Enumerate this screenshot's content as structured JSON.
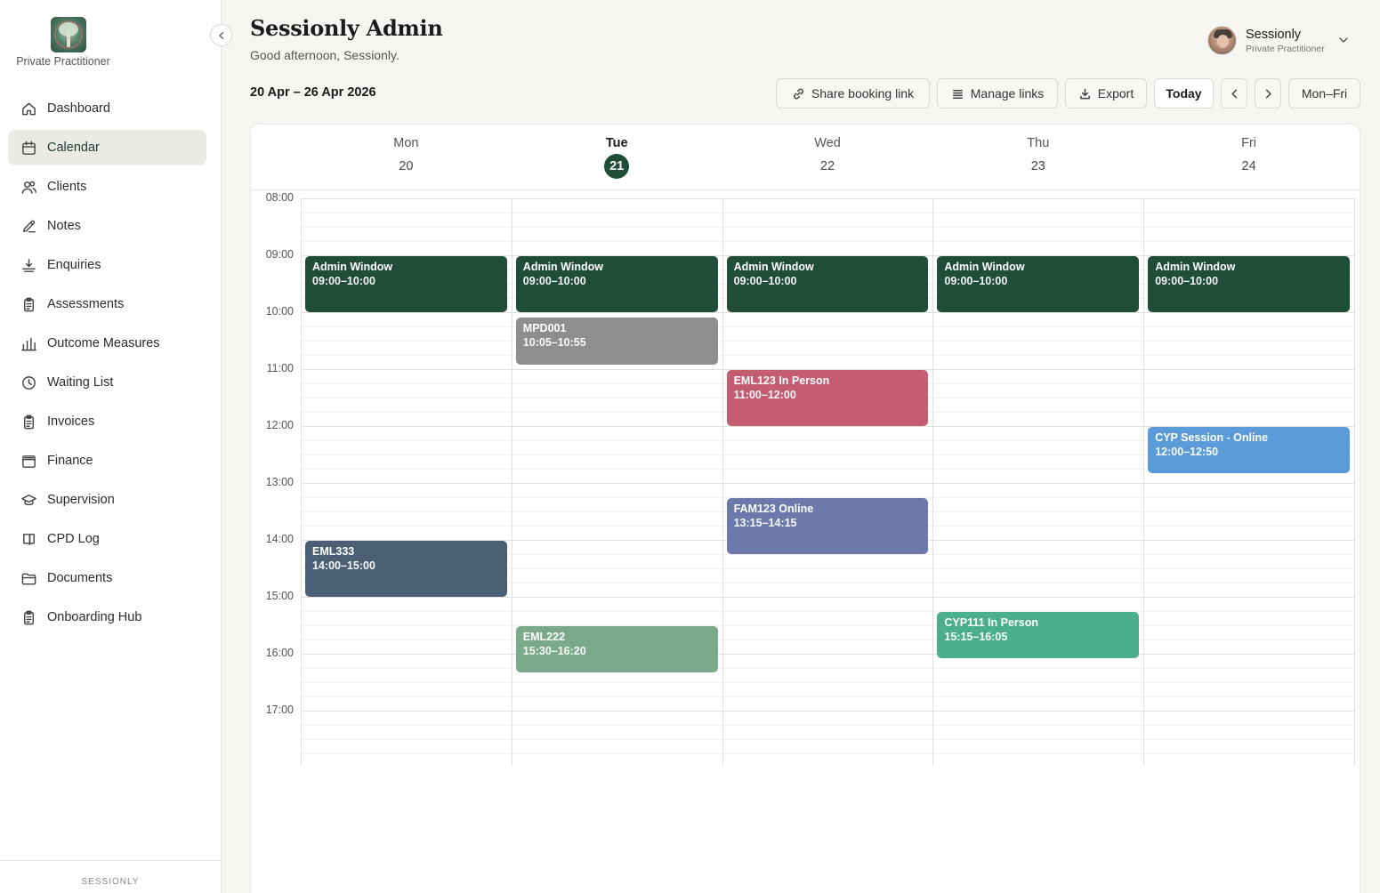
{
  "sidebar": {
    "brand_subtitle": "Private Practitioner",
    "items": [
      {
        "label": "Dashboard",
        "icon": "home-icon"
      },
      {
        "label": "Calendar",
        "icon": "calendar-icon",
        "active": true
      },
      {
        "label": "Clients",
        "icon": "users-icon"
      },
      {
        "label": "Notes",
        "icon": "pencil-icon"
      },
      {
        "label": "Enquiries",
        "icon": "inbox-download-icon"
      },
      {
        "label": "Assessments",
        "icon": "clipboard-icon"
      },
      {
        "label": "Outcome Measures",
        "icon": "bar-chart-icon"
      },
      {
        "label": "Waiting List",
        "icon": "clock-icon"
      },
      {
        "label": "Invoices",
        "icon": "clipboard-icon"
      },
      {
        "label": "Finance",
        "icon": "wallet-icon"
      },
      {
        "label": "Supervision",
        "icon": "graduation-cap-icon"
      },
      {
        "label": "CPD Log",
        "icon": "book-icon"
      },
      {
        "label": "Documents",
        "icon": "folder-icon"
      },
      {
        "label": "Onboarding Hub",
        "icon": "clipboard-icon"
      }
    ],
    "footer": "SESSIONLY"
  },
  "header": {
    "title": "Sessionly Admin",
    "greeting": "Good afternoon, Sessionly."
  },
  "user": {
    "name": "Sessionly",
    "role": "Private Practitioner"
  },
  "toolbar": {
    "range": "20 Apr – 26 Apr 2026",
    "share_label": "Share booking link",
    "manage_label": "Manage links",
    "export_label": "Export",
    "today_label": "Today",
    "view_label": "Mon–Fri"
  },
  "calendar": {
    "days": [
      {
        "name": "Mon",
        "num": "20"
      },
      {
        "name": "Tue",
        "num": "21",
        "today": true
      },
      {
        "name": "Wed",
        "num": "22"
      },
      {
        "name": "Thu",
        "num": "23"
      },
      {
        "name": "Fri",
        "num": "24"
      }
    ],
    "hours": [
      "08:00",
      "09:00",
      "10:00",
      "11:00",
      "12:00",
      "13:00",
      "14:00",
      "15:00",
      "16:00",
      "17:00"
    ],
    "events": [
      {
        "day": 0,
        "title": "Admin Window",
        "time": "09:00–10:00",
        "color": "#1f4d3a"
      },
      {
        "day": 1,
        "title": "Admin Window",
        "time": "09:00–10:00",
        "color": "#1f4d3a"
      },
      {
        "day": 2,
        "title": "Admin Window",
        "time": "09:00–10:00",
        "color": "#1f4d3a"
      },
      {
        "day": 3,
        "title": "Admin Window",
        "time": "09:00–10:00",
        "color": "#1f4d3a"
      },
      {
        "day": 4,
        "title": "Admin Window",
        "time": "09:00–10:00",
        "color": "#1f4d3a"
      },
      {
        "day": 1,
        "title": "MPD001",
        "time": "10:05–10:55",
        "color": "#8e8e8e"
      },
      {
        "day": 2,
        "title": "EML123 In Person",
        "time": "11:00–12:00",
        "color": "#c55d72"
      },
      {
        "day": 4,
        "title": "CYP Session - Online",
        "time": "12:00–12:50",
        "color": "#5b9bd8"
      },
      {
        "day": 2,
        "title": "FAM123 Online",
        "time": "13:15–14:15",
        "color": "#6b79ab"
      },
      {
        "day": 0,
        "title": "EML333",
        "time": "14:00–15:00",
        "color": "#4b6075"
      },
      {
        "day": 1,
        "title": "EML222",
        "time": "15:30–16:20",
        "color": "#7aaa8a"
      },
      {
        "day": 3,
        "title": "CYP111 In Person",
        "time": "15:15–16:05",
        "color": "#4caf8c"
      }
    ]
  }
}
